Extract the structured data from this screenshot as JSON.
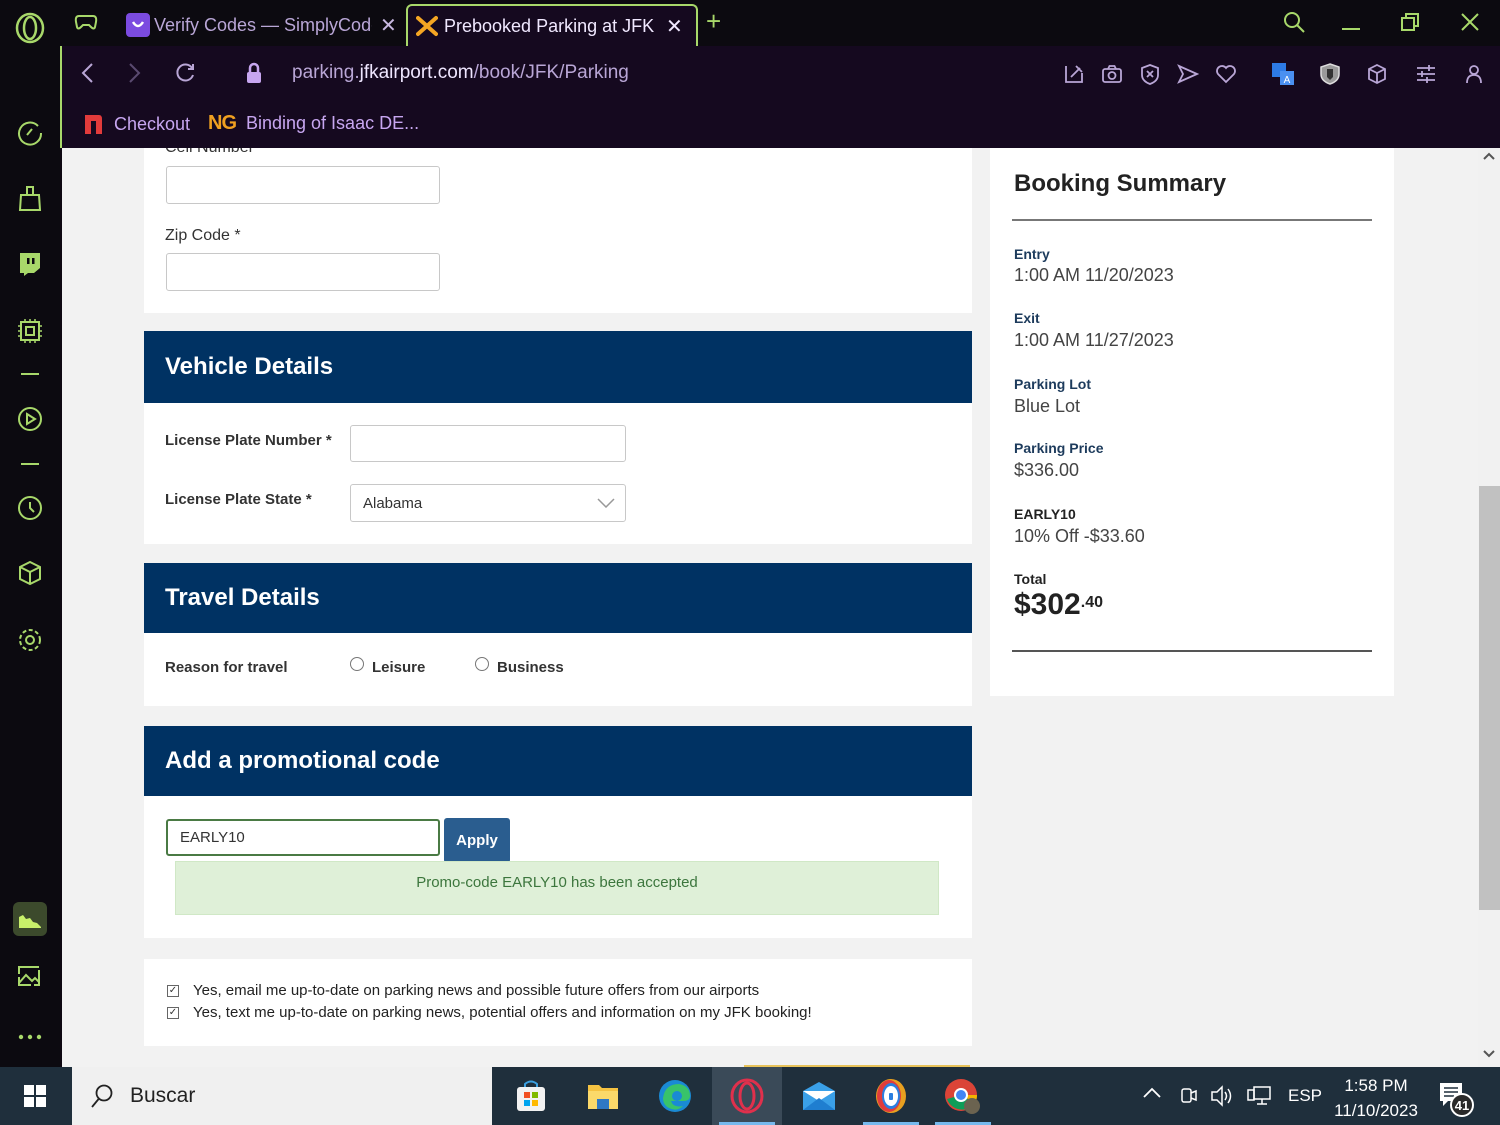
{
  "browser": {
    "tabs": [
      {
        "label": "Verify Codes — SimplyCodes",
        "icon": "simplycodes-icon",
        "active": false
      },
      {
        "label": "Prebooked Parking at JFK Airport",
        "icon": "jfk-plane-icon",
        "active": true
      }
    ],
    "new_tab_label": "+",
    "url": {
      "prefix": "parking.",
      "domain": "jfkairport.com",
      "path": "/book/JFK/Parking"
    },
    "bookmarks": [
      {
        "label": "Checkout",
        "icon": "n-logo-icon"
      },
      {
        "label": "Binding of Isaac DE...",
        "icon": "ng-logo-icon"
      }
    ],
    "toolbar_icons": [
      "pin-icon",
      "camera-icon",
      "shield-x-icon",
      "send-icon",
      "heart-icon",
      "translate-icon",
      "vpn-shield-icon",
      "cube-icon",
      "easy-setup-icon",
      "profile-icon"
    ],
    "window_controls": [
      "search-icon",
      "minimize-icon",
      "restore-icon",
      "close-icon"
    ],
    "sidebar_icons": [
      "speed-dial-icon",
      "cleaner-icon",
      "twitch-icon",
      "cpu-icon",
      "player-icon",
      "history-icon",
      "cube-icon",
      "settings-icon",
      "chart-icon",
      "image-icon",
      "more-icon"
    ]
  },
  "form": {
    "cell_number": {
      "label": "Cell Number",
      "value": ""
    },
    "zip_code": {
      "label": "Zip Code *",
      "value": ""
    },
    "vehicle": {
      "title": "Vehicle Details",
      "plate_number_label": "License Plate Number *",
      "plate_number_value": "",
      "plate_state_label": "License Plate State *",
      "plate_state_value": "Alabama"
    },
    "travel": {
      "title": "Travel Details",
      "reason_label": "Reason for travel",
      "options": [
        "Leisure",
        "Business"
      ]
    },
    "promo": {
      "title": "Add a promotional code",
      "code_value": "EARLY10",
      "apply_label": "Apply",
      "success_message": "Promo-code EARLY10 has been accepted"
    },
    "consents": [
      {
        "label": "Yes, email me up-to-date on parking news and possible future offers from our airports",
        "checked": true
      },
      {
        "label": "Yes, text me up-to-date on parking news, potential offers and information on my JFK booking!",
        "checked": true
      }
    ]
  },
  "summary": {
    "title": "Booking Summary",
    "entry_label": "Entry",
    "entry_value": "1:00 AM 11/20/2023",
    "exit_label": "Exit",
    "exit_value": "1:00 AM 11/27/2023",
    "lot_label": "Parking Lot",
    "lot_value": "Blue Lot",
    "price_label": "Parking Price",
    "price_value": "$336.00",
    "discount_label": "EARLY10",
    "discount_value": "10% Off -$33.60",
    "total_label": "Total",
    "total_main": "$302",
    "total_cents": ".40"
  },
  "taskbar": {
    "search_placeholder": "Buscar",
    "language": "ESP",
    "time": "1:58 PM",
    "date": "11/10/2023",
    "notification_count": "41"
  },
  "colors": {
    "header_navy": "#003263",
    "accent_green": "#a8d86a",
    "success_bg": "#dff0d8",
    "apply_button": "#2a5d8f"
  }
}
